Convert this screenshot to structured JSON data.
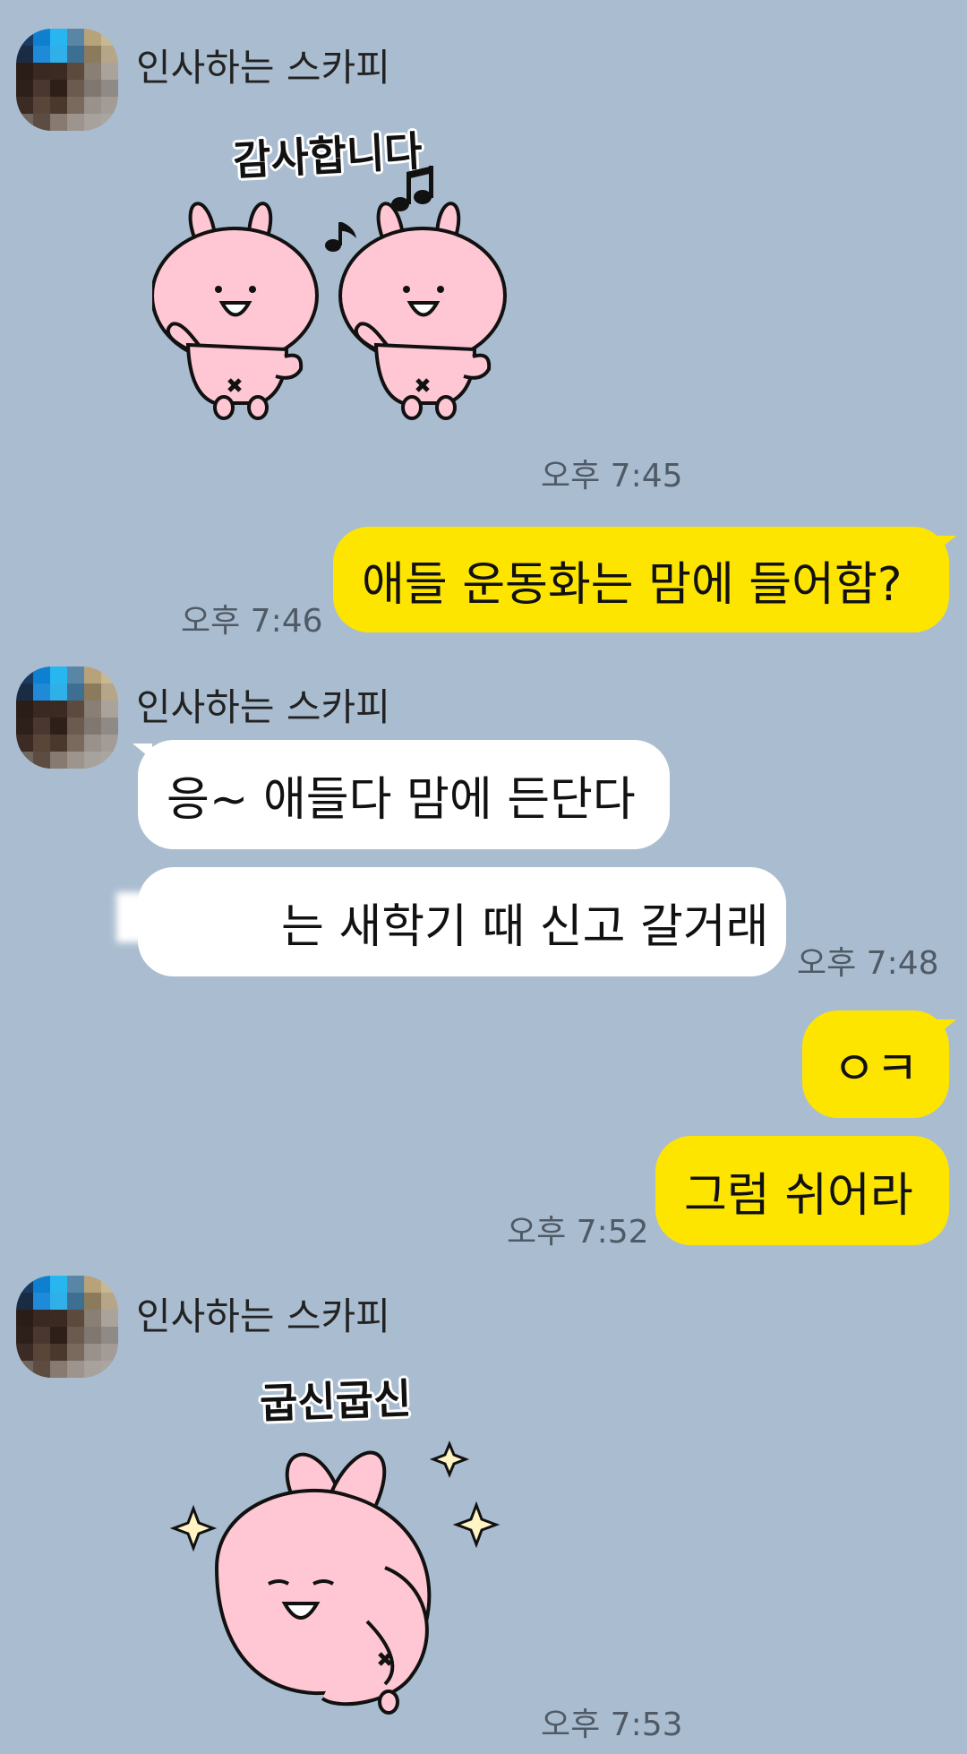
{
  "sender_name": "인사하는 스카피",
  "colors": {
    "background": "#aabdd0",
    "incoming_bubble": "#ffffff",
    "outgoing_bubble": "#fee500",
    "sticker_pink": "#ffc6d3",
    "time_text": "#4f5a66"
  },
  "messages": [
    {
      "id": "m1",
      "from": "other",
      "type": "sticker",
      "caption": "감사합니다",
      "sticker": "two-dancing-bunnies",
      "time": "오후 7:45"
    },
    {
      "id": "m2",
      "from": "me",
      "type": "text",
      "text": "애들 운동화는 맘에 들어함?",
      "time": "오후 7:46"
    },
    {
      "id": "m3",
      "from": "other",
      "type": "text",
      "text": "응~ 애들다 맘에 든단다"
    },
    {
      "id": "m4",
      "from": "other",
      "type": "text",
      "text": "는 새학기 때 신고 갈거래",
      "time": "오후 7:48"
    },
    {
      "id": "m5",
      "from": "me",
      "type": "text",
      "text": "ㅇㅋ"
    },
    {
      "id": "m6",
      "from": "me",
      "type": "text",
      "text": "그럼 쉬어라",
      "time": "오후 7:52"
    },
    {
      "id": "m7",
      "from": "other",
      "type": "sticker",
      "caption": "굽신굽신",
      "sticker": "bowing-bunny",
      "time": "오후 7:53"
    }
  ]
}
